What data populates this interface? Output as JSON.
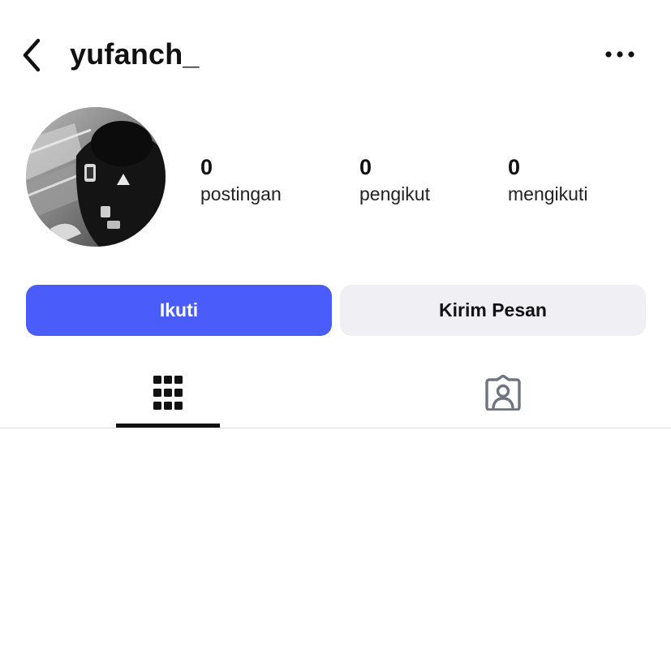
{
  "header": {
    "username": "yufanch_",
    "back_icon": "chevron-left-icon",
    "more_icon": "more-horizontal-icon"
  },
  "profile": {
    "avatar": "profile-photo"
  },
  "stats": {
    "posts": {
      "count": "0",
      "label": "postingan"
    },
    "followers": {
      "count": "0",
      "label": "pengikut"
    },
    "following": {
      "count": "0",
      "label": "mengikuti"
    }
  },
  "actions": {
    "follow_label": "Ikuti",
    "message_label": "Kirim Pesan"
  },
  "tabs": [
    {
      "icon": "grid-icon",
      "selected": true
    },
    {
      "icon": "tagged-person-icon",
      "selected": false
    }
  ],
  "colors": {
    "follow_button": "#4a5dfb",
    "message_button": "#efeff4",
    "text": "#111111",
    "tagged_icon": "#6e7480",
    "divider": "#dbdbdb"
  }
}
